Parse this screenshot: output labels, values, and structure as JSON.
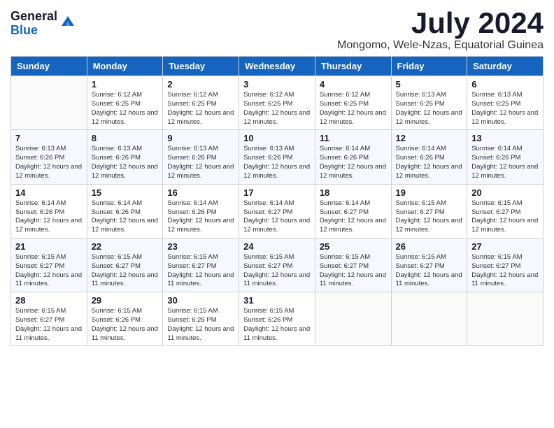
{
  "header": {
    "logo_general": "General",
    "logo_blue": "Blue",
    "month_title": "July 2024",
    "subtitle": "Mongomo, Wele-Nzas, Equatorial Guinea"
  },
  "days_of_week": [
    "Sunday",
    "Monday",
    "Tuesday",
    "Wednesday",
    "Thursday",
    "Friday",
    "Saturday"
  ],
  "weeks": [
    [
      {
        "day": "",
        "info": ""
      },
      {
        "day": "1",
        "info": "Sunrise: 6:12 AM\nSunset: 6:25 PM\nDaylight: 12 hours and 12 minutes."
      },
      {
        "day": "2",
        "info": "Sunrise: 6:12 AM\nSunset: 6:25 PM\nDaylight: 12 hours and 12 minutes."
      },
      {
        "day": "3",
        "info": "Sunrise: 6:12 AM\nSunset: 6:25 PM\nDaylight: 12 hours and 12 minutes."
      },
      {
        "day": "4",
        "info": "Sunrise: 6:12 AM\nSunset: 6:25 PM\nDaylight: 12 hours and 12 minutes."
      },
      {
        "day": "5",
        "info": "Sunrise: 6:13 AM\nSunset: 6:25 PM\nDaylight: 12 hours and 12 minutes."
      },
      {
        "day": "6",
        "info": "Sunrise: 6:13 AM\nSunset: 6:25 PM\nDaylight: 12 hours and 12 minutes."
      }
    ],
    [
      {
        "day": "7",
        "info": "Sunrise: 6:13 AM\nSunset: 6:26 PM\nDaylight: 12 hours and 12 minutes."
      },
      {
        "day": "8",
        "info": "Sunrise: 6:13 AM\nSunset: 6:26 PM\nDaylight: 12 hours and 12 minutes."
      },
      {
        "day": "9",
        "info": "Sunrise: 6:13 AM\nSunset: 6:26 PM\nDaylight: 12 hours and 12 minutes."
      },
      {
        "day": "10",
        "info": "Sunrise: 6:13 AM\nSunset: 6:26 PM\nDaylight: 12 hours and 12 minutes."
      },
      {
        "day": "11",
        "info": "Sunrise: 6:14 AM\nSunset: 6:26 PM\nDaylight: 12 hours and 12 minutes."
      },
      {
        "day": "12",
        "info": "Sunrise: 6:14 AM\nSunset: 6:26 PM\nDaylight: 12 hours and 12 minutes."
      },
      {
        "day": "13",
        "info": "Sunrise: 6:14 AM\nSunset: 6:26 PM\nDaylight: 12 hours and 12 minutes."
      }
    ],
    [
      {
        "day": "14",
        "info": "Sunrise: 6:14 AM\nSunset: 6:26 PM\nDaylight: 12 hours and 12 minutes."
      },
      {
        "day": "15",
        "info": "Sunrise: 6:14 AM\nSunset: 6:26 PM\nDaylight: 12 hours and 12 minutes."
      },
      {
        "day": "16",
        "info": "Sunrise: 6:14 AM\nSunset: 6:26 PM\nDaylight: 12 hours and 12 minutes."
      },
      {
        "day": "17",
        "info": "Sunrise: 6:14 AM\nSunset: 6:27 PM\nDaylight: 12 hours and 12 minutes."
      },
      {
        "day": "18",
        "info": "Sunrise: 6:14 AM\nSunset: 6:27 PM\nDaylight: 12 hours and 12 minutes."
      },
      {
        "day": "19",
        "info": "Sunrise: 6:15 AM\nSunset: 6:27 PM\nDaylight: 12 hours and 12 minutes."
      },
      {
        "day": "20",
        "info": "Sunrise: 6:15 AM\nSunset: 6:27 PM\nDaylight: 12 hours and 12 minutes."
      }
    ],
    [
      {
        "day": "21",
        "info": "Sunrise: 6:15 AM\nSunset: 6:27 PM\nDaylight: 12 hours and 11 minutes."
      },
      {
        "day": "22",
        "info": "Sunrise: 6:15 AM\nSunset: 6:27 PM\nDaylight: 12 hours and 11 minutes."
      },
      {
        "day": "23",
        "info": "Sunrise: 6:15 AM\nSunset: 6:27 PM\nDaylight: 12 hours and 11 minutes."
      },
      {
        "day": "24",
        "info": "Sunrise: 6:15 AM\nSunset: 6:27 PM\nDaylight: 12 hours and 11 minutes."
      },
      {
        "day": "25",
        "info": "Sunrise: 6:15 AM\nSunset: 6:27 PM\nDaylight: 12 hours and 11 minutes."
      },
      {
        "day": "26",
        "info": "Sunrise: 6:15 AM\nSunset: 6:27 PM\nDaylight: 12 hours and 11 minutes."
      },
      {
        "day": "27",
        "info": "Sunrise: 6:15 AM\nSunset: 6:27 PM\nDaylight: 12 hours and 11 minutes."
      }
    ],
    [
      {
        "day": "28",
        "info": "Sunrise: 6:15 AM\nSunset: 6:27 PM\nDaylight: 12 hours and 11 minutes."
      },
      {
        "day": "29",
        "info": "Sunrise: 6:15 AM\nSunset: 6:26 PM\nDaylight: 12 hours and 11 minutes."
      },
      {
        "day": "30",
        "info": "Sunrise: 6:15 AM\nSunset: 6:26 PM\nDaylight: 12 hours and 11 minutes."
      },
      {
        "day": "31",
        "info": "Sunrise: 6:15 AM\nSunset: 6:26 PM\nDaylight: 12 hours and 11 minutes."
      },
      {
        "day": "",
        "info": ""
      },
      {
        "day": "",
        "info": ""
      },
      {
        "day": "",
        "info": ""
      }
    ]
  ]
}
